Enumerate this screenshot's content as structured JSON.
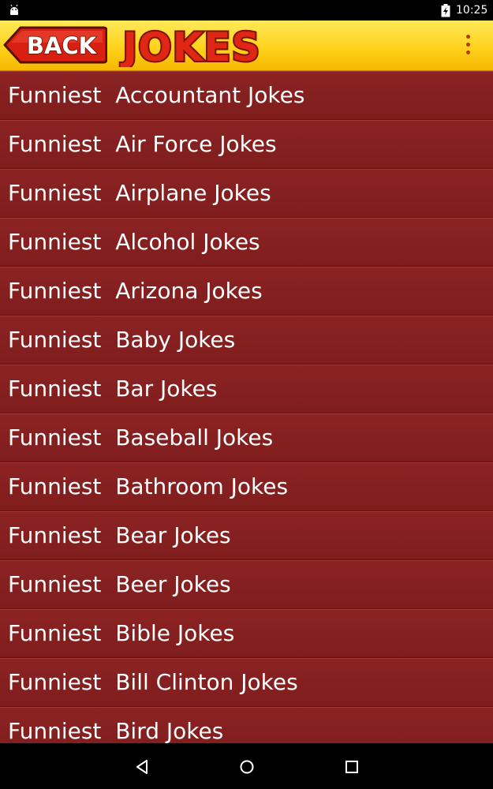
{
  "status_bar": {
    "time": "10:25",
    "left_icon": "android-icon",
    "right_icon": "battery-icon"
  },
  "app_bar": {
    "back_label": "BACK",
    "logo_text": "JOKES",
    "menu_icon": "overflow-menu-icon",
    "colors": {
      "bar": "#ffd21c",
      "back_button": "#d81f12",
      "logo_fill": "#e02615",
      "logo_outline": "#7a1300"
    }
  },
  "list": {
    "prefix": "Funniest",
    "items": [
      "Accountant Jokes",
      "Air Force Jokes",
      "Airplane Jokes",
      "Alcohol Jokes",
      "Arizona Jokes",
      "Baby Jokes",
      "Bar Jokes",
      "Baseball Jokes",
      "Bathroom Jokes",
      "Bear Jokes",
      "Beer Jokes",
      "Bible Jokes",
      "Bill Clinton Jokes",
      "Bird Jokes"
    ],
    "colors": {
      "row": "#8c2323",
      "text": "#ffffff"
    }
  },
  "nav_bar": {
    "buttons": [
      "back-icon",
      "home-icon",
      "recents-icon"
    ]
  }
}
